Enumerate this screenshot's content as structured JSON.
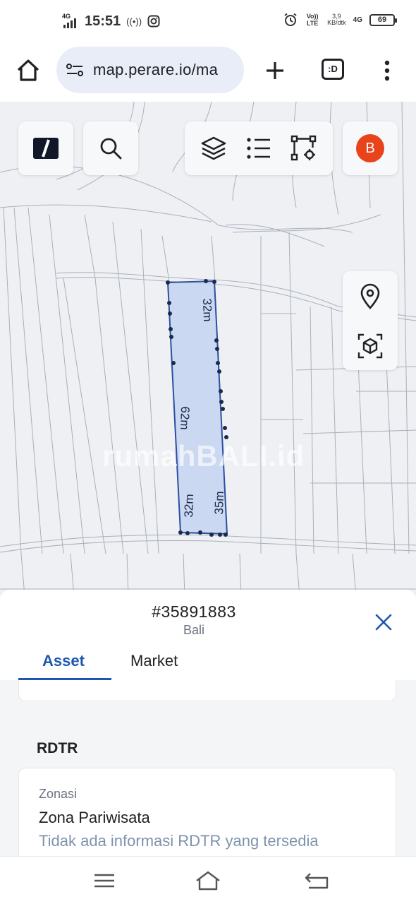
{
  "status_bar": {
    "network_left": "4G",
    "time": "15:51",
    "volte": "Vo)) LTE",
    "speed_value": "3,9",
    "speed_unit": "KB/dtk",
    "network_right": "4G",
    "battery": "69"
  },
  "browser": {
    "url": "map.perare.io/ma",
    "tabs_label": ":D"
  },
  "map": {
    "watermark": "rumahBALI.id",
    "avatar_letter": "B",
    "avatar_color": "#e8431b",
    "parcel_fill": "#c3d3f0",
    "parcel_stroke": "#2c4fa0",
    "dimensions": {
      "top": "32m",
      "left": "62m",
      "bottom_left": "32m",
      "bottom_right": "35m"
    }
  },
  "sheet": {
    "parcel_id": "#35891883",
    "region": "Bali",
    "tabs": [
      {
        "label": "Asset",
        "active": true
      },
      {
        "label": "Market",
        "active": false
      }
    ],
    "rdtr": {
      "title": "RDTR",
      "zonasi_label": "Zonasi",
      "zonasi_value": "Zona Pariwisata",
      "info": "Tidak ada informasi RDTR yang tersedia"
    }
  },
  "colors": {
    "accent": "#1f57b0"
  }
}
